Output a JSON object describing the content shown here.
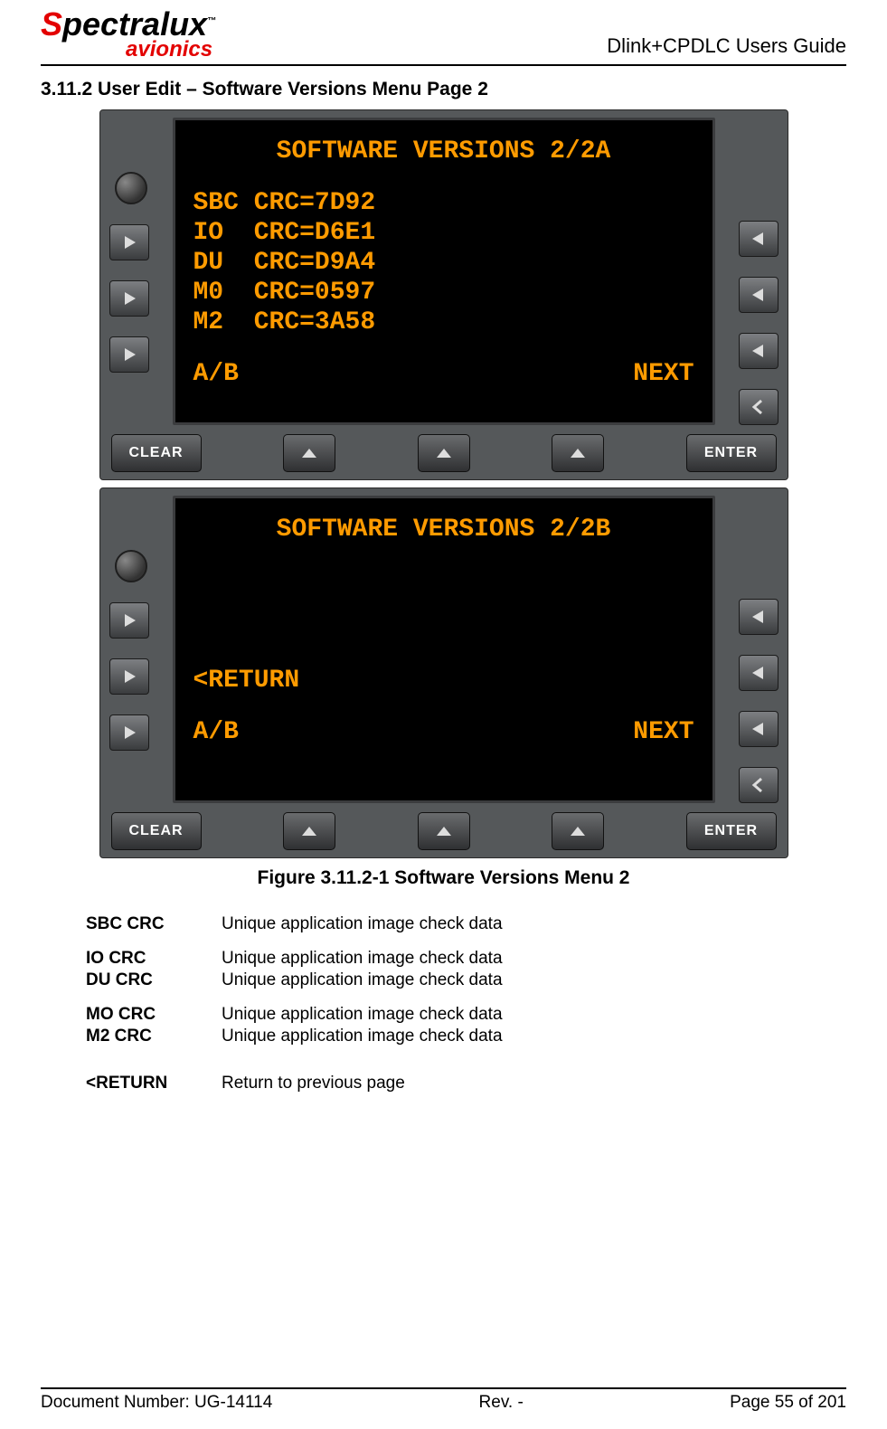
{
  "header": {
    "logo_main": "Spectralux",
    "logo_sub": "avionics",
    "guide_title": "Dlink+CPDLC Users Guide"
  },
  "section_title": "3.11.2 User Edit – Software Versions Menu Page 2",
  "device_a": {
    "screen_title": "SOFTWARE VERSIONS 2/2A",
    "lines": [
      "SBC CRC=7D92",
      "IO  CRC=D6E1",
      "DU  CRC=D9A4",
      "M0  CRC=0597",
      "M2  CRC=3A58"
    ],
    "bottom_left": "A/B",
    "bottom_right": "NEXT",
    "clear_label": "CLEAR",
    "enter_label": "ENTER"
  },
  "device_b": {
    "screen_title": "SOFTWARE VERSIONS 2/2B",
    "return_label": "<RETURN",
    "bottom_left": "A/B",
    "bottom_right": "NEXT",
    "clear_label": "CLEAR",
    "enter_label": "ENTER"
  },
  "figure_caption": "Figure 3.11.2-1 Software Versions Menu 2",
  "definitions": [
    {
      "label": "SBC CRC",
      "value": "Unique application image check data"
    },
    {
      "label": "IO CRC",
      "value": "Unique application image check data"
    },
    {
      "label": "DU CRC",
      "value": "Unique application image check data"
    },
    {
      "label": "MO CRC",
      "value": "Unique application image check data"
    },
    {
      "label": "M2 CRC",
      "value": "Unique application image check data"
    },
    {
      "label": "<RETURN",
      "value": "Return to previous page"
    }
  ],
  "footer": {
    "doc_number": "Document Number:  UG-14114",
    "rev": "Rev. -",
    "page": "Page 55 of 201"
  }
}
